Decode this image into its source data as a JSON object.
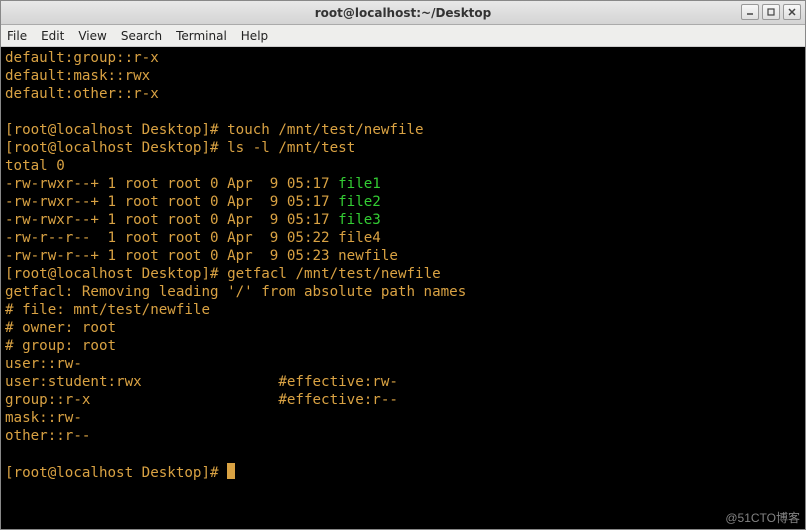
{
  "window": {
    "title": "root@localhost:~/Desktop"
  },
  "menubar": {
    "file": "File",
    "edit": "Edit",
    "view": "View",
    "search": "Search",
    "terminal": "Terminal",
    "help": "Help"
  },
  "prompt": {
    "bracket_open": "[",
    "bracket_close": "]",
    "user_host": "root@localhost",
    "cwd": " Desktop",
    "sep": "# "
  },
  "top_defaults": {
    "l1": "default:group::r-x",
    "l2": "default:mask::rwx",
    "l3": "default:other::r-x"
  },
  "cmd1": "touch /mnt/test/newfile",
  "cmd2": "ls -l /mnt/test",
  "ls": {
    "total": "total 0",
    "rows": [
      {
        "perm": "-rw-rwxr--+ 1 root root 0 Apr  9 05:17 ",
        "name": "file1",
        "color": "green"
      },
      {
        "perm": "-rw-rwxr--+ 1 root root 0 Apr  9 05:17 ",
        "name": "file2",
        "color": "green"
      },
      {
        "perm": "-rw-rwxr--+ 1 root root 0 Apr  9 05:17 ",
        "name": "file3",
        "color": "green"
      },
      {
        "perm": "-rw-r--r--  1 root root 0 Apr  9 05:22 ",
        "name": "file4",
        "color": "orange"
      },
      {
        "perm": "-rw-rw-r--+ 1 root root 0 Apr  9 05:23 ",
        "name": "newfile",
        "color": "orange"
      }
    ]
  },
  "cmd3": "getfacl /mnt/test/newfile",
  "getfacl": {
    "warn": "getfacl: Removing leading '/' from absolute path names",
    "file": "# file: mnt/test/newfile",
    "owner": "# owner: root",
    "group": "# group: root",
    "entries": [
      "user::rw-",
      "user:student:rwx                #effective:rw-",
      "group::r-x                      #effective:r--",
      "mask::rw-",
      "other::r--"
    ]
  },
  "watermark": "@51CTO博客"
}
